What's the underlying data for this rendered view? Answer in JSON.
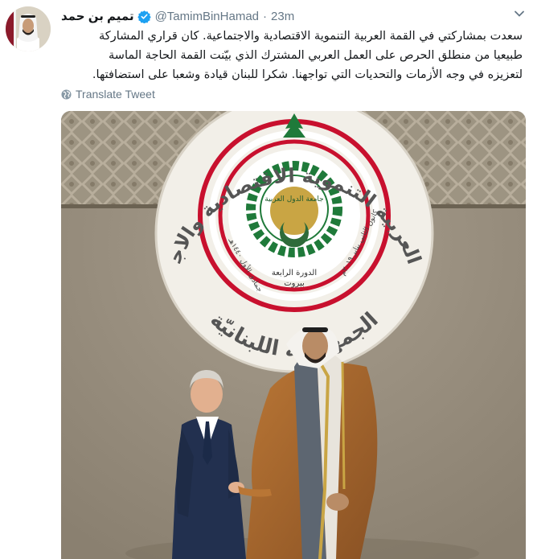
{
  "user": {
    "display_name": "تميم بن حمد",
    "handle": "@TamimBinHamad",
    "time": "23m",
    "verified": true
  },
  "tweet": {
    "lines": [
      "سعدت بمشاركتي في القمة العربية التنموية الاقتصادية والاجتماعية. كان قراري المشاركة",
      "طبيعيا من منطلق الحرص على العمل العربي المشترك الذي بيّنت القمة الحاجة الماسة",
      "لتعزيزه في وجه الأزمات والتحديات التي تواجهنا. شكرا للبنان قيادة وشعبا على استضافتها."
    ]
  },
  "translate_label": "Translate Tweet",
  "photo": {
    "emblem_outer_text": "القمة العربية التنموية الاقتصادية والاجتماعية",
    "emblem_bottom_text": "الجمهوريّة اللبنانيّة",
    "emblem_session_text": "الدورة الرابعة",
    "emblem_city_text": "بيروت",
    "emblem_date_left": "جمادى الأول ١٤٤٠هـ",
    "emblem_date_right": "كانون الثاني يناير ٢٠١٩م",
    "league_logo_text": "جامعة الدول العربية"
  },
  "colors": {
    "text": "#14171a",
    "muted": "#657786",
    "verified_blue": "#1da1f2",
    "emblem_red": "#c8102e",
    "emblem_green": "#1f7a3a",
    "robe_brown": "#a9672e",
    "suit_navy": "#22304f"
  },
  "icons": [
    "verified-badge-icon",
    "chevron-down-icon",
    "globe-icon"
  ]
}
